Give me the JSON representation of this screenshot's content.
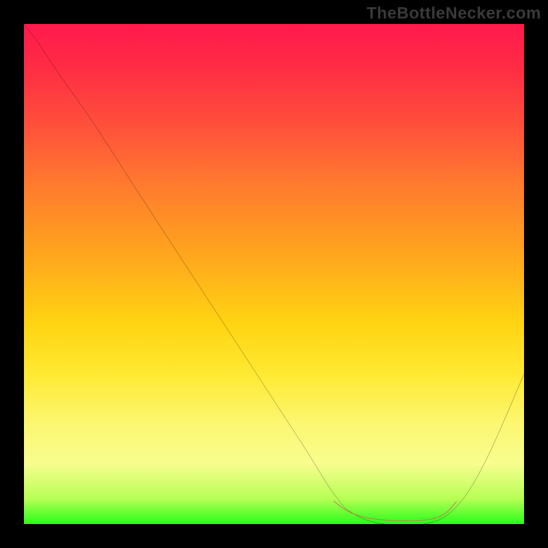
{
  "watermark": "TheBottleNecker.com",
  "chart_data": {
    "type": "line",
    "title": "",
    "xlabel": "",
    "ylabel": "",
    "xlim": [
      0,
      100
    ],
    "ylim": [
      0,
      100
    ],
    "gradient_stops": [
      {
        "pos": 0,
        "color": "#ff1a4d"
      },
      {
        "pos": 8,
        "color": "#ff2a44"
      },
      {
        "pos": 20,
        "color": "#ff4f3b"
      },
      {
        "pos": 32,
        "color": "#ff7a2e"
      },
      {
        "pos": 45,
        "color": "#ffa21e"
      },
      {
        "pos": 60,
        "color": "#ffd412"
      },
      {
        "pos": 70,
        "color": "#ffe932"
      },
      {
        "pos": 80,
        "color": "#fcf772"
      },
      {
        "pos": 88,
        "color": "#f7fd8e"
      },
      {
        "pos": 95,
        "color": "#b6ff54"
      },
      {
        "pos": 100,
        "color": "#27ff1a"
      }
    ],
    "series": [
      {
        "name": "bottleneck-curve",
        "stroke": "#000000",
        "points": [
          {
            "x": 0.0,
            "y": 100.0
          },
          {
            "x": 3.0,
            "y": 96.0
          },
          {
            "x": 7.0,
            "y": 90.0
          },
          {
            "x": 14.0,
            "y": 80.0
          },
          {
            "x": 25.0,
            "y": 63.0
          },
          {
            "x": 40.0,
            "y": 40.0
          },
          {
            "x": 55.0,
            "y": 17.0
          },
          {
            "x": 62.0,
            "y": 6.0
          },
          {
            "x": 66.0,
            "y": 2.0
          },
          {
            "x": 72.0,
            "y": 0.0
          },
          {
            "x": 80.0,
            "y": 0.0
          },
          {
            "x": 86.0,
            "y": 3.0
          },
          {
            "x": 92.0,
            "y": 12.0
          },
          {
            "x": 100.0,
            "y": 30.0
          }
        ]
      },
      {
        "name": "flat-marker",
        "stroke": "#d4655c",
        "points": [
          {
            "x": 62.0,
            "y": 4.5
          },
          {
            "x": 66.0,
            "y": 2.0
          },
          {
            "x": 72.0,
            "y": 0.8
          },
          {
            "x": 80.0,
            "y": 0.8
          },
          {
            "x": 84.0,
            "y": 2.0
          },
          {
            "x": 86.5,
            "y": 4.5
          }
        ]
      }
    ]
  }
}
